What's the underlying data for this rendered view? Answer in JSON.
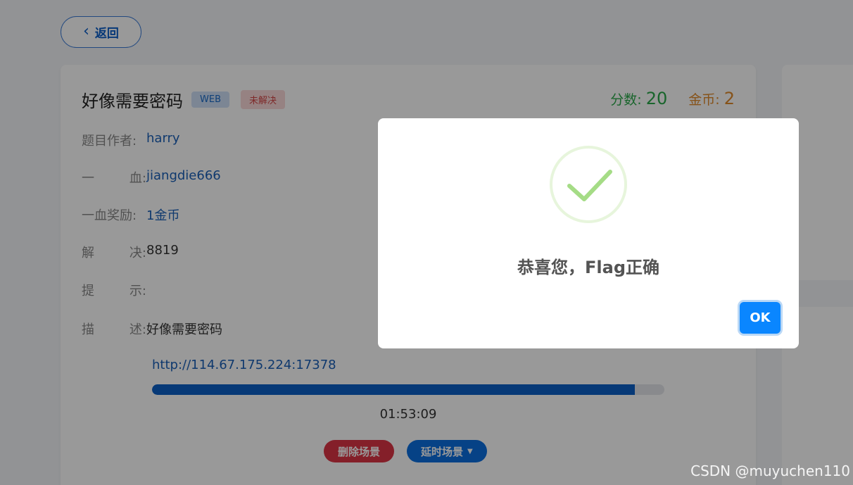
{
  "nav": {
    "back_label": "返回"
  },
  "challenge": {
    "title": "好像需要密码",
    "category_tag": "WEB",
    "status_tag": "未解决",
    "score_label": "分数:",
    "score_value": "20",
    "coin_label": "金币:",
    "coin_value": "2",
    "fields": [
      {
        "label": [
          "题目作者:"
        ],
        "value": "harry",
        "link": true
      },
      {
        "label": [
          "一",
          "血:"
        ],
        "value": "jiangdie666",
        "link": true
      },
      {
        "label": [
          "一血奖励:"
        ],
        "value": "1金币",
        "link": true
      },
      {
        "label": [
          "解",
          "决:"
        ],
        "value": "8819",
        "link": false
      },
      {
        "label": [
          "提",
          "示:"
        ],
        "value": "",
        "link": false
      },
      {
        "label": [
          "描",
          "述:"
        ],
        "value": "好像需要密码",
        "link": false
      }
    ],
    "url": "http://114.67.175.224:17378",
    "progress_fraction": 0.942,
    "timer": "01:53:09",
    "delete_label": "删除场景",
    "extend_label": "延时场景"
  },
  "modal": {
    "icon": "success-check-icon",
    "message": "恭喜您，Flag正确",
    "ok_label": "OK"
  },
  "watermark": "CSDN @muyuchen110",
  "colors": {
    "primary": "#0a5fc7",
    "success": "#2aa84a",
    "coin": "#e08a2c",
    "danger": "#dc3545",
    "check": "#a5dc86"
  }
}
